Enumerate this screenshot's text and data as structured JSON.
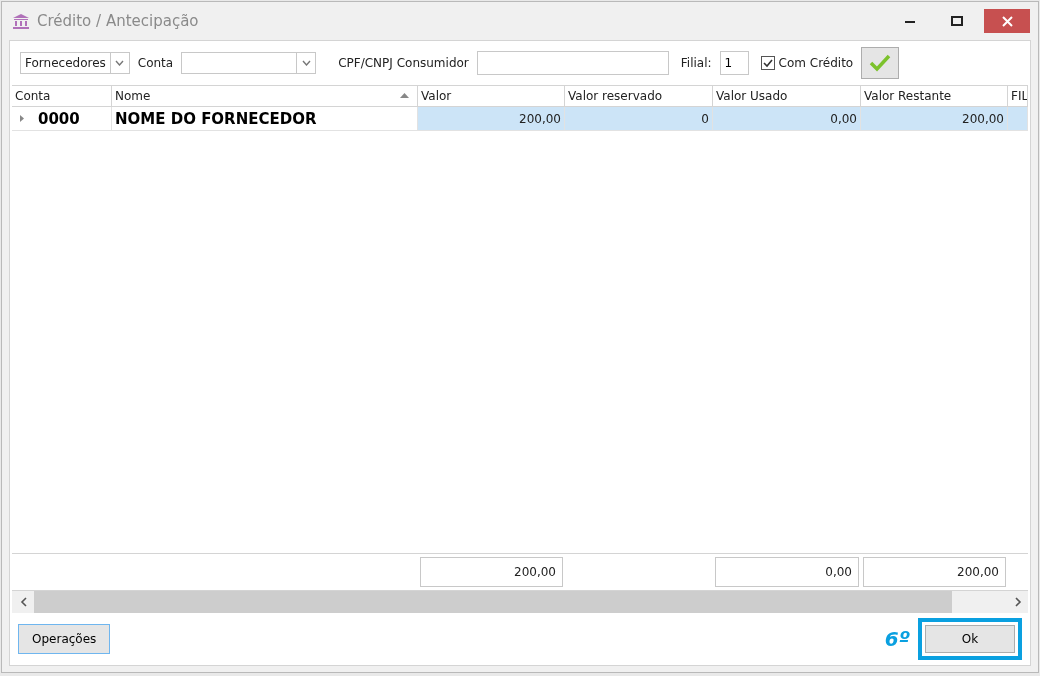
{
  "window": {
    "title": "Crédito / Antecipação"
  },
  "filters": {
    "type_select": {
      "value": "Fornecedores"
    },
    "conta": {
      "label": "Conta"
    },
    "cpf": {
      "label": "CPF/CNPJ Consumidor"
    },
    "filial": {
      "label": "Filial:",
      "value": "1"
    },
    "com_credito": {
      "label": "Com Crédito",
      "checked": true
    }
  },
  "table": {
    "columns": [
      {
        "label": "Conta",
        "sorted": false
      },
      {
        "label": "Nome",
        "sorted": true
      },
      {
        "label": "Valor",
        "sorted": false
      },
      {
        "label": "Valor reservado",
        "sorted": false
      },
      {
        "label": "Valor Usado",
        "sorted": false
      },
      {
        "label": "Valor Restante",
        "sorted": false
      },
      {
        "label": "FIL",
        "sorted": false
      }
    ],
    "rows": [
      {
        "selected": true,
        "cells": [
          "0000",
          "NOME DO FORNECEDOR",
          "200,00",
          "0",
          "0,00",
          "200,00"
        ]
      }
    ],
    "totals": {
      "valor": "200,00",
      "valor_usado": "0,00",
      "valor_restante": "200,00"
    }
  },
  "buttons": {
    "operacoes": "Operações",
    "ok": "Ok"
  },
  "annotation": {
    "step": "6º",
    "highlighted": true
  }
}
